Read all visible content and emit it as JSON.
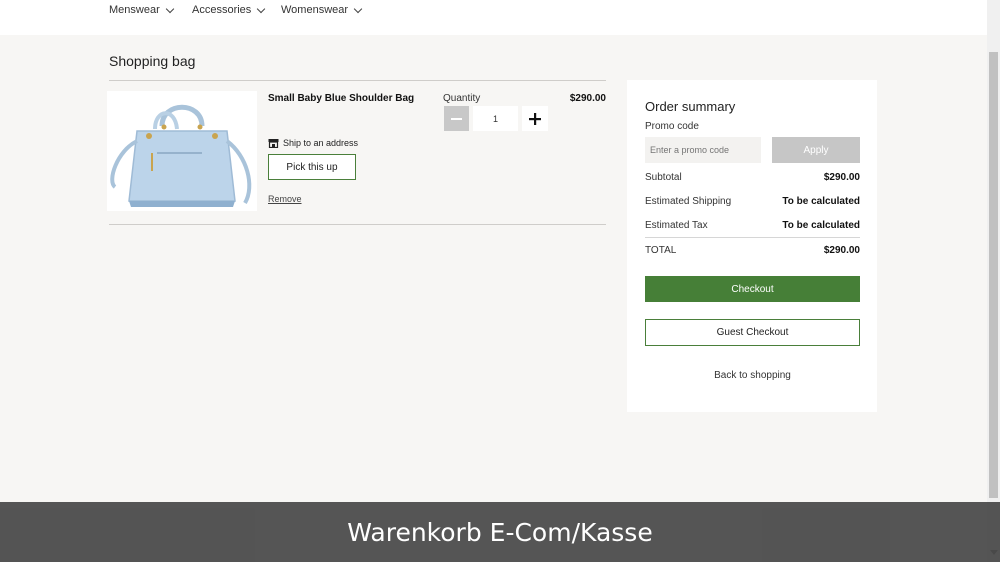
{
  "nav": {
    "items": [
      {
        "label": "Menswear"
      },
      {
        "label": "Accessories"
      },
      {
        "label": "Womenswear"
      }
    ]
  },
  "page": {
    "title": "Shopping bag"
  },
  "cart": {
    "items": [
      {
        "name": "Small Baby Blue Shoulder Bag",
        "ship_label": "Ship to an address",
        "pickup_label": "Pick this up",
        "remove_label": "Remove",
        "quantity_label": "Quantity",
        "quantity": "1",
        "price": "$290.00",
        "image_icon": "handbag-image"
      }
    ]
  },
  "summary": {
    "title": "Order summary",
    "promo_label": "Promo code",
    "promo_placeholder": "Enter a promo code",
    "apply_label": "Apply",
    "subtotal_label": "Subtotal",
    "subtotal_value": "$290.00",
    "shipping_label": "Estimated Shipping",
    "shipping_value": "To be calculated",
    "tax_label": "Estimated Tax",
    "tax_value": "To be calculated",
    "total_label": "TOTAL",
    "total_value": "$290.00",
    "checkout_label": "Checkout",
    "guest_checkout_label": "Guest Checkout",
    "back_label": "Back to shopping"
  },
  "caption": {
    "text": "Warenkorb E-Com/Kasse"
  },
  "colors": {
    "accent_green": "#467f37",
    "background": "#f7f6f4",
    "apply_disabled": "#c6c6c6"
  }
}
